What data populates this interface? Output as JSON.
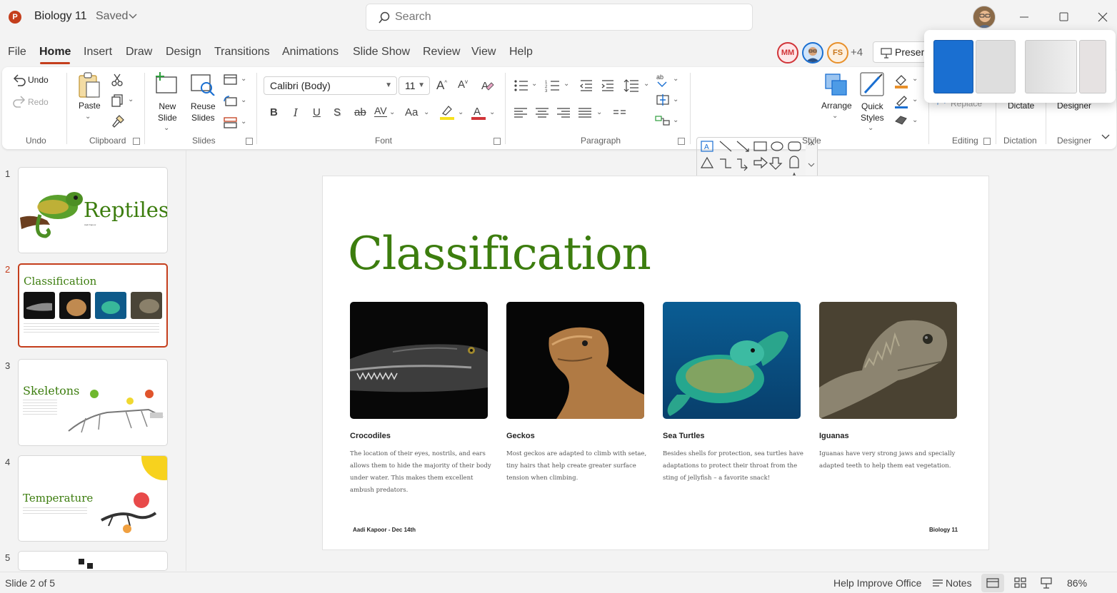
{
  "app": {
    "logo_letter": "P",
    "doc_title": "Biology 11",
    "save_status": "Saved"
  },
  "search": {
    "placeholder": "Search"
  },
  "tabs": [
    "File",
    "Home",
    "Insert",
    "Draw",
    "Design",
    "Transitions",
    "Animations",
    "Slide Show",
    "Review",
    "View",
    "Help"
  ],
  "collaborators": [
    {
      "initials": "MM",
      "color": "#d13438"
    },
    {
      "initials": "",
      "color": "#1a6fd1"
    },
    {
      "initials": "FS",
      "color": "#e8902a"
    }
  ],
  "collaborators_more": "+4",
  "present_label": "Present",
  "ribbon": {
    "undo": {
      "undo": "Undo",
      "redo": "Redo",
      "group": "Undo"
    },
    "clipboard": {
      "paste": "Paste",
      "group": "Clipboard"
    },
    "slides": {
      "new_slide": [
        "New",
        "Slide"
      ],
      "reuse": [
        "Reuse",
        "Slides"
      ],
      "group": "Slides"
    },
    "font": {
      "family": "Calibri (Body)",
      "size": "11",
      "bold": "B",
      "italic": "I",
      "underline": "U",
      "shadow": "S",
      "strike": "ab",
      "spacing": "AV",
      "case": "Aa",
      "group": "Font"
    },
    "paragraph": {
      "group": "Paragraph"
    },
    "style": {
      "arrange": "Arrange",
      "quick_styles": [
        "Quick",
        "Styles"
      ],
      "group": "Style"
    },
    "editing": {
      "label": "Replace",
      "group": "Editing"
    },
    "dictation": {
      "label": "Dictate",
      "group": "Dictation"
    },
    "designer": {
      "label": "Designer",
      "group": "Designer"
    }
  },
  "thumbnails": [
    {
      "num": "1",
      "title": "Reptiles",
      "sub": "Aadi Kapoor"
    },
    {
      "num": "2",
      "title": "Classification"
    },
    {
      "num": "3",
      "title": "Skeletons"
    },
    {
      "num": "4",
      "title": "Temperature"
    },
    {
      "num": "5",
      "title": ""
    }
  ],
  "slide": {
    "title": "Classification",
    "cards": [
      {
        "heading": "Crocodiles",
        "text": "The location of their eyes, nostrils, and ears allows them to hide the majority of their body under water. This makes them excellent ambush predators."
      },
      {
        "heading": "Geckos",
        "text": "Most geckos are adapted to climb with setae, tiny hairs that help create greater surface tension when climbing."
      },
      {
        "heading": "Sea Turtles",
        "text": "Besides shells for protection, sea turtles have adaptations to protect their throat from the sting of jellyfish – a favorite snack!"
      },
      {
        "heading": "Iguanas",
        "text": "Iguanas have very strong jaws and specially adapted teeth to help them eat vegetation."
      }
    ],
    "footer_left": "Aadi Kapoor - Dec 14th",
    "footer_right": "Biology 11"
  },
  "status": {
    "slide_count": "Slide 2 of 5",
    "help": "Help Improve Office",
    "notes": "Notes",
    "zoom": "86%"
  },
  "colors": {
    "accent": "#c43e1c",
    "title_green": "#3c7d0e"
  }
}
